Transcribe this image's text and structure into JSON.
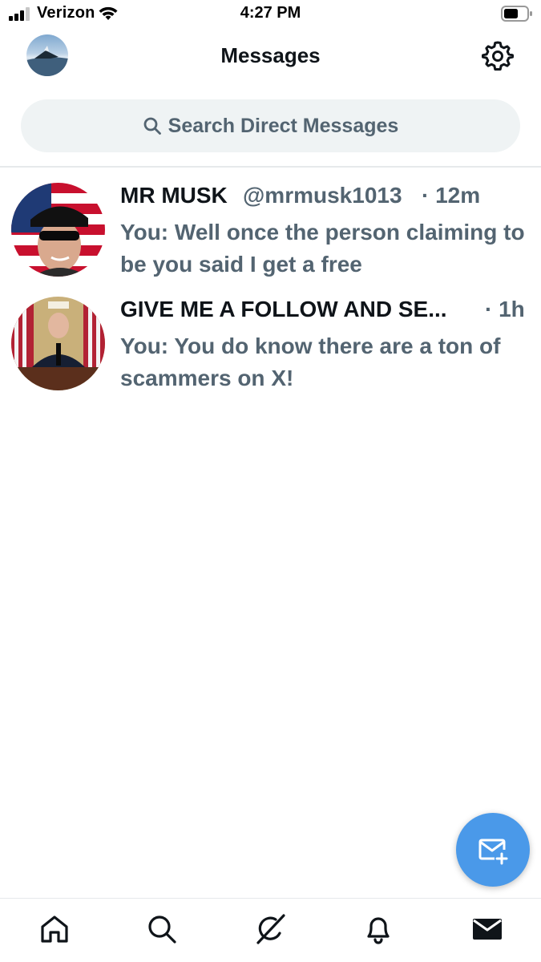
{
  "status_bar": {
    "carrier": "Verizon",
    "time": "4:27 PM"
  },
  "header": {
    "title": "Messages",
    "settings_icon": "gear-icon"
  },
  "search": {
    "placeholder": "Search Direct Messages",
    "icon": "search-icon"
  },
  "conversations": [
    {
      "name": "MR MUSK",
      "handle": "@mrmusk1013",
      "time": "· 12m",
      "preview": "You: Well once the person claiming to be you said I get a free"
    },
    {
      "name": "GIVE ME A FOLLOW AND SE...",
      "handle": "",
      "time": "· 1h",
      "preview": "You: You do know there are a ton of scammers on X!"
    }
  ],
  "fab": {
    "icon": "new-message-icon"
  },
  "bottom_nav": {
    "items": [
      "home-icon",
      "search-icon",
      "grok-icon",
      "notifications-bell-icon",
      "messages-envelope-icon"
    ],
    "active": "messages-envelope-icon"
  },
  "colors": {
    "primary_text": "#0f1419",
    "secondary_text": "#536471",
    "accent": "#4a99e9",
    "search_bg": "#eff3f4"
  }
}
